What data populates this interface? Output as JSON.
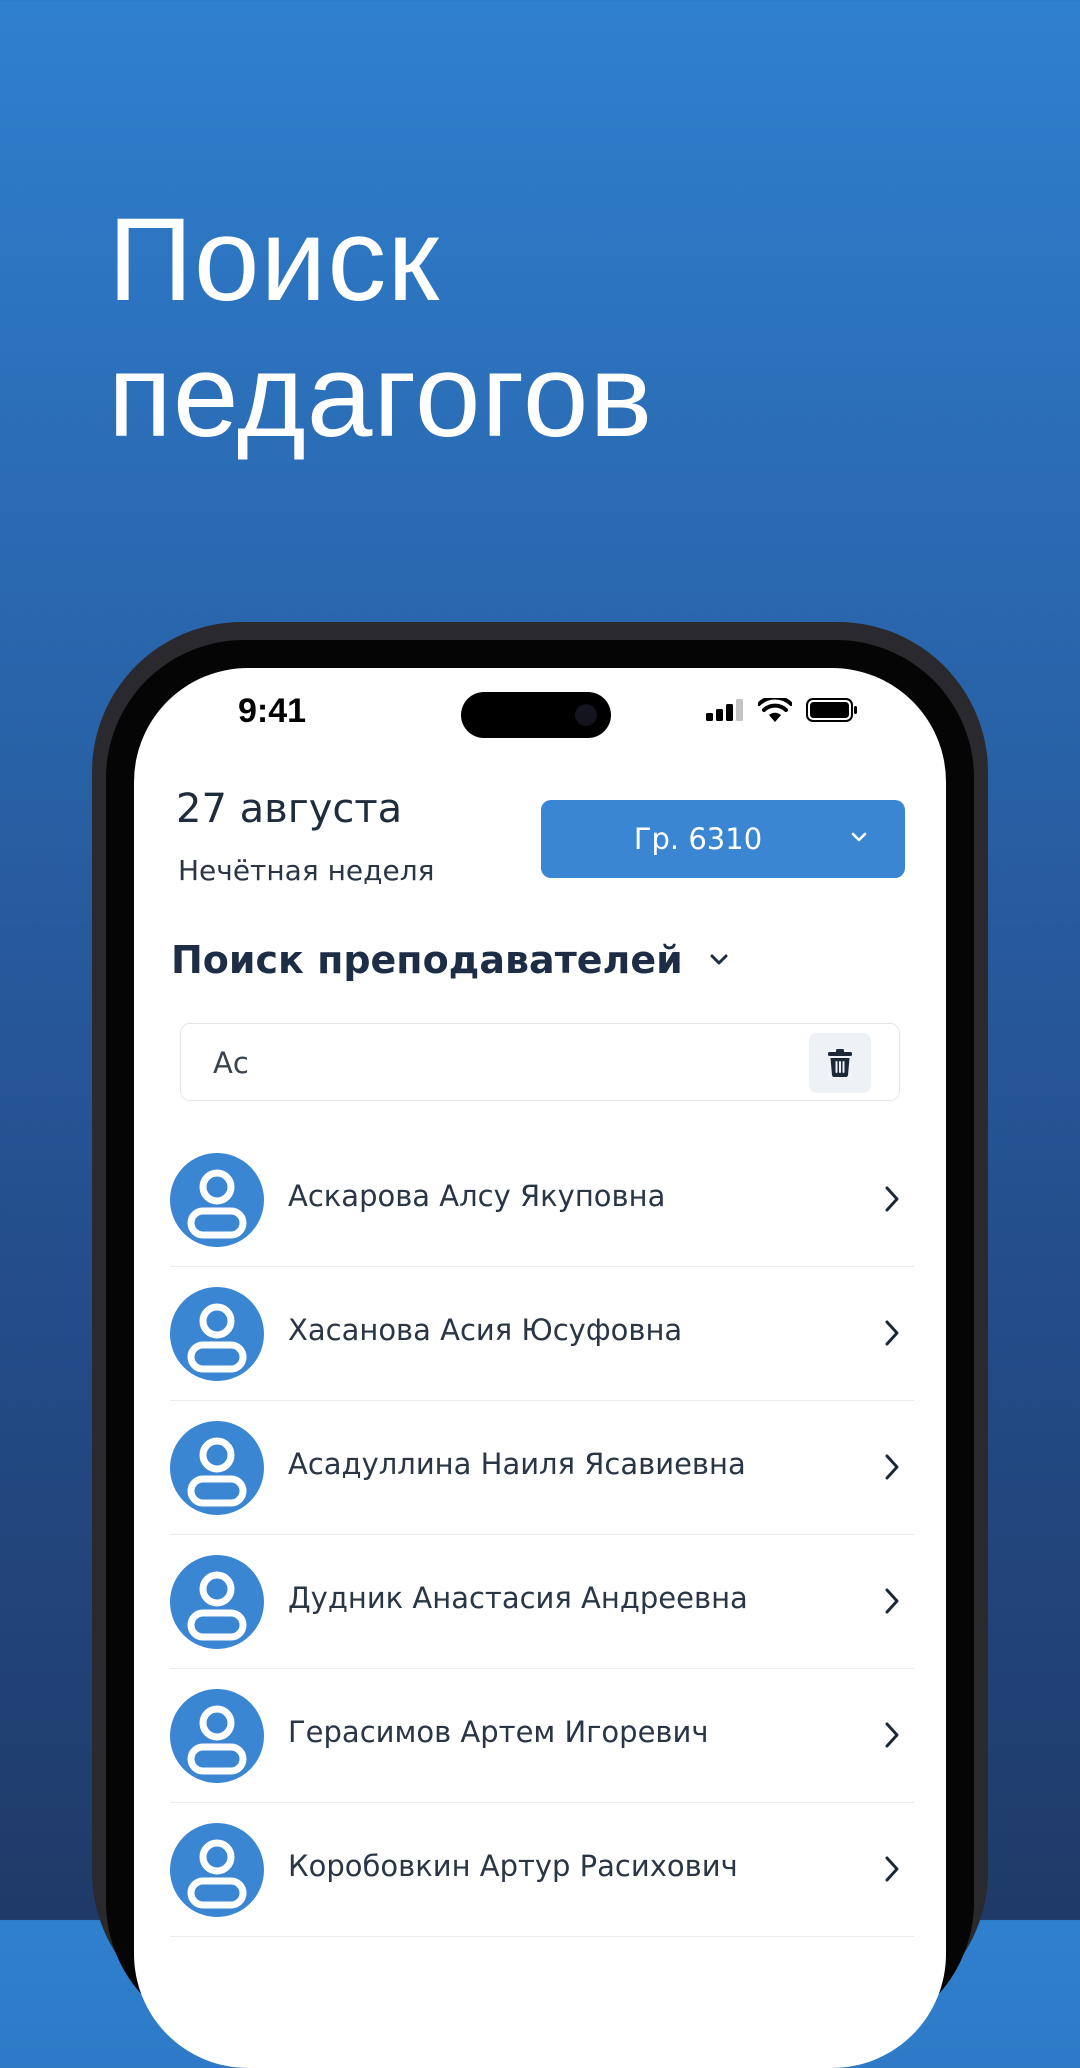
{
  "promo": {
    "title_line1": "Поиск",
    "title_line2": "педагогов"
  },
  "status_bar": {
    "time": "9:41",
    "icons": [
      "signal-icon",
      "wifi-icon",
      "battery-icon"
    ]
  },
  "header": {
    "date": "27 августа",
    "week": "Нечётная неделя",
    "group_button_label": "Гр. 6310"
  },
  "section": {
    "title": "Поиск преподавателей"
  },
  "search": {
    "value": "Ас"
  },
  "teachers": [
    {
      "name": "Аскарова Алсу Якуповна"
    },
    {
      "name": "Хасанова Асия Юсуфовна"
    },
    {
      "name": "Асадуллина Наиля Ясавиевна"
    },
    {
      "name": "Дудник Анастасия Андреевна"
    },
    {
      "name": "Герасимов Артем Игоревич"
    },
    {
      "name": "Коробовкин Артур Расихович"
    }
  ],
  "colors": {
    "accent": "#3a86d3",
    "title_text": "#1c2d45",
    "background_top": "#2f80cf",
    "background_bottom": "#1f3a68"
  }
}
